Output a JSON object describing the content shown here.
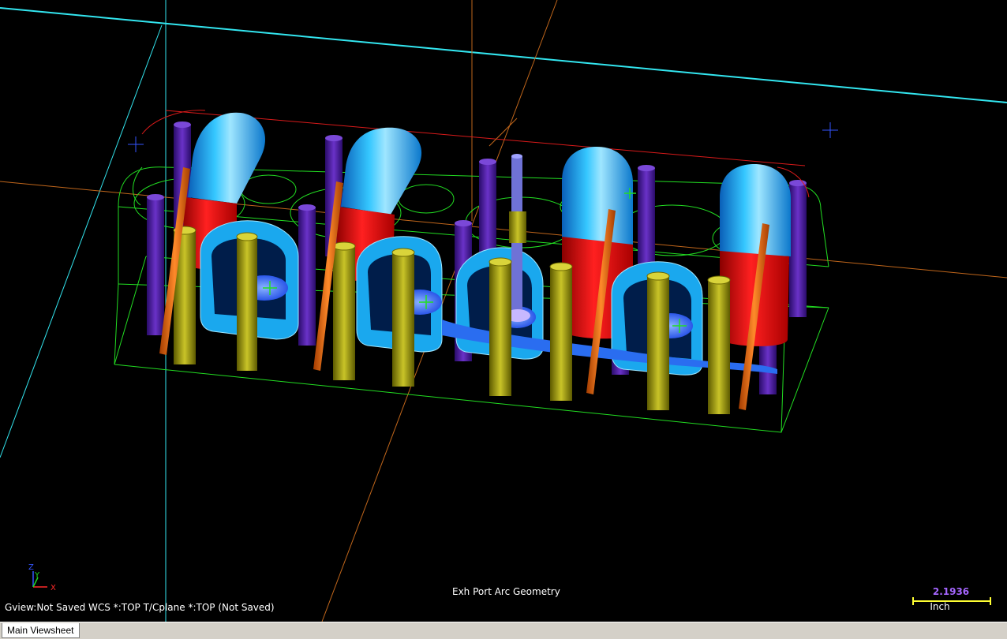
{
  "viewport": {
    "status_line": "Gview:Not Saved   WCS *:TOP   T/Cplane *:TOP (Not Saved)",
    "view_title": "Exh Port Arc Geometry",
    "scale": {
      "value": "2.1936",
      "unit": "Inch"
    },
    "axis_labels": {
      "x": "X",
      "y": "Y",
      "z": "Z"
    }
  },
  "tabs": [
    {
      "label": "Main Viewsheet"
    }
  ],
  "colors": {
    "background": "#000000",
    "wireframe": "#22dd22",
    "cyan_axis": "#33e6f0",
    "orange_axis": "#c0661b",
    "port_blue": "#1aa8ee",
    "port_red": "#e01010",
    "stud_purple": "#5a22b0",
    "stud_olive": "#b7b21a",
    "pushrod_orange": "#ef6a10",
    "scale_value": "#a566ff",
    "scale_bar": "#ffff33"
  }
}
